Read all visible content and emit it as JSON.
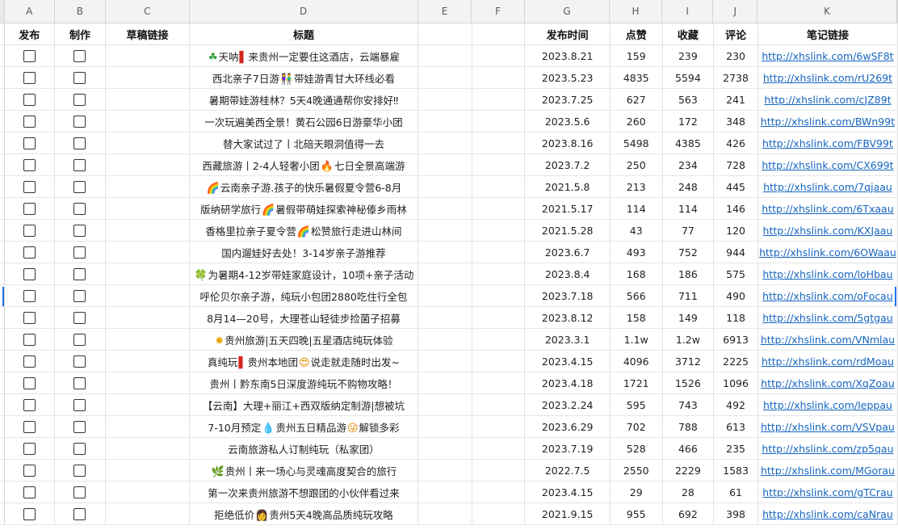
{
  "columns": [
    "A",
    "B",
    "C",
    "D",
    "E",
    "F",
    "G",
    "H",
    "I",
    "J",
    "K"
  ],
  "headers": {
    "publish": "发布",
    "make": "制作",
    "draft_link": "草稿链接",
    "title": "标题",
    "publish_time": "发布时间",
    "likes": "点赞",
    "favorites": "收藏",
    "comments": "评论",
    "note_link": "笔记链接"
  },
  "rows": [
    {
      "pre": "",
      "emoji": "☘",
      "emoji_name": "clover",
      "mid": "天呐",
      "emoji2": "▌",
      "emoji2_name": "bar",
      "post": "来贵州一定要住这酒店，云端暴雇",
      "date": "2023.8.21",
      "likes": "159",
      "fav": "239",
      "comments": "230",
      "link": "http://xhslink.com/6wSF8t"
    },
    {
      "pre": "西北亲子7日游",
      "emoji": "👫",
      "emoji_name": "people",
      "mid": "带娃游青甘大环线必看",
      "emoji2": "",
      "emoji2_name": "",
      "post": "",
      "date": "2023.5.23",
      "likes": "4835",
      "fav": "5594",
      "comments": "2738",
      "link": "http://xhslink.com/rU269t"
    },
    {
      "pre": "暑期带娃游桂林？5天4晚通通帮你安排好‼",
      "emoji": "",
      "emoji_name": "",
      "mid": "",
      "emoji2": "",
      "emoji2_name": "",
      "post": "",
      "date": "2023.7.25",
      "likes": "627",
      "fav": "563",
      "comments": "241",
      "link": "http://xhslink.com/cJZ89t"
    },
    {
      "pre": "一次玩遍美西全景！黄石公园6日游豪华小团",
      "emoji": "",
      "emoji_name": "",
      "mid": "",
      "emoji2": "",
      "emoji2_name": "",
      "post": "",
      "date": "2023.5.6",
      "likes": "260",
      "fav": "172",
      "comments": "348",
      "link": "http://xhslink.com/BWn99t"
    },
    {
      "pre": "替大家试过了丨北碚天眼洞值得一去",
      "emoji": "",
      "emoji_name": "",
      "mid": "",
      "emoji2": "",
      "emoji2_name": "",
      "post": "",
      "date": "2023.8.16",
      "likes": "5498",
      "fav": "4385",
      "comments": "426",
      "link": "http://xhslink.com/FBV99t"
    },
    {
      "pre": "西藏旅游丨2-4人轻奢小团",
      "emoji": "🔥",
      "emoji_name": "fire",
      "mid": "七日全景高端游",
      "emoji2": "",
      "emoji2_name": "",
      "post": "",
      "date": "2023.7.2",
      "likes": "250",
      "fav": "234",
      "comments": "728",
      "link": "http://xhslink.com/CX699t"
    },
    {
      "pre": "",
      "emoji": "🌈",
      "emoji_name": "rainbow",
      "mid": "云南亲子游.孩子的快乐暑假夏令营6-8月",
      "emoji2": "",
      "emoji2_name": "",
      "post": "",
      "date": "2021.5.8",
      "likes": "213",
      "fav": "248",
      "comments": "445",
      "link": "http://xhslink.com/7qjaau"
    },
    {
      "pre": "版纳研学旅行",
      "emoji": "🌈",
      "emoji_name": "rainbow",
      "mid": "暑假带萌娃探索神秘傣乡雨林",
      "emoji2": "",
      "emoji2_name": "",
      "post": "",
      "date": "2021.5.17",
      "likes": "114",
      "fav": "114",
      "comments": "146",
      "link": "http://xhslink.com/6Txaau"
    },
    {
      "pre": "香格里拉亲子夏令营",
      "emoji": "🌈",
      "emoji_name": "rainbow",
      "mid": "松赞旅行走进山林间",
      "emoji2": "",
      "emoji2_name": "",
      "post": "",
      "date": "2021.5.28",
      "likes": "43",
      "fav": "77",
      "comments": "120",
      "link": "http://xhslink.com/KXJaau"
    },
    {
      "pre": "国内遛娃好去处！3-14岁亲子游推荐",
      "emoji": "",
      "emoji_name": "",
      "mid": "",
      "emoji2": "",
      "emoji2_name": "",
      "post": "",
      "date": "2023.6.7",
      "likes": "493",
      "fav": "752",
      "comments": "944",
      "link": "http://xhslink.com/6OWaau"
    },
    {
      "pre": "",
      "emoji": "🍀",
      "emoji_name": "clover",
      "mid": "为暑期4-12岁带娃家庭设计，10项+亲子活动",
      "emoji2": "",
      "emoji2_name": "",
      "post": "",
      "date": "2023.8.4",
      "likes": "168",
      "fav": "186",
      "comments": "575",
      "link": "http://xhslink.com/loHbau"
    },
    {
      "pre": "呼伦贝尔亲子游，纯玩小包团2880吃住行全包",
      "emoji": "",
      "emoji_name": "",
      "mid": "",
      "emoji2": "",
      "emoji2_name": "",
      "post": "",
      "date": "2023.7.18",
      "likes": "566",
      "fav": "711",
      "comments": "490",
      "link": "http://xhslink.com/oFocau"
    },
    {
      "pre": "8月14—20号，大理苍山轻徒步捡菌子招募",
      "emoji": "",
      "emoji_name": "",
      "mid": "",
      "emoji2": "",
      "emoji2_name": "",
      "post": "",
      "date": "2023.8.12",
      "likes": "158",
      "fav": "149",
      "comments": "118",
      "link": "http://xhslink.com/5gtgau"
    },
    {
      "pre": "",
      "emoji": "✸",
      "emoji_name": "star",
      "mid": "贵州旅游|五天四晚|五星酒店纯玩体验",
      "emoji2": "",
      "emoji2_name": "",
      "post": "",
      "date": "2023.3.1",
      "likes": "1.1w",
      "fav": "1.2w",
      "comments": "6913",
      "link": "http://xhslink.com/VNmlau"
    },
    {
      "pre": "真纯玩",
      "emoji": "▌",
      "emoji_name": "bar",
      "mid": "贵州本地团",
      "emoji2": "😍",
      "emoji2_name": "face",
      "post": "说走就走随时出发~",
      "date": "2023.4.15",
      "likes": "4096",
      "fav": "3712",
      "comments": "2225",
      "link": "http://xhslink.com/rdMoau"
    },
    {
      "pre": "贵州丨黔东南5日深度游纯玩不购物攻略！",
      "emoji": "",
      "emoji_name": "",
      "mid": "",
      "emoji2": "",
      "emoji2_name": "",
      "post": "",
      "date": "2023.4.18",
      "likes": "1721",
      "fav": "1526",
      "comments": "1096",
      "link": "http://xhslink.com/XqZoau"
    },
    {
      "pre": "【云南】大理+丽江+西双版纳定制游|想被坑",
      "emoji": "",
      "emoji_name": "",
      "mid": "",
      "emoji2": "",
      "emoji2_name": "",
      "post": "",
      "date": "2023.2.24",
      "likes": "595",
      "fav": "743",
      "comments": "492",
      "link": "http://xhslink.com/Ieppau"
    },
    {
      "pre": "7-10月预定",
      "emoji": "💧",
      "emoji_name": "fire",
      "mid": "贵州五日精品游",
      "emoji2": "😜",
      "emoji2_name": "face",
      "post": "解锁多彩",
      "date": "2023.6.29",
      "likes": "702",
      "fav": "788",
      "comments": "613",
      "link": "http://xhslink.com/VSVpau"
    },
    {
      "pre": "云南旅游私人订制纯玩（私家团）",
      "emoji": "",
      "emoji_name": "",
      "mid": "",
      "emoji2": "",
      "emoji2_name": "",
      "post": "",
      "date": "2023.7.19",
      "likes": "528",
      "fav": "466",
      "comments": "235",
      "link": "http://xhslink.com/zp5qau"
    },
    {
      "pre": "",
      "emoji": "🌿",
      "emoji_name": "leaf",
      "mid": "贵州丨来一场心与灵魂高度契合的旅行",
      "emoji2": "",
      "emoji2_name": "",
      "post": "",
      "date": "2022.7.5",
      "likes": "2550",
      "fav": "2229",
      "comments": "1583",
      "link": "http://xhslink.com/MGorau"
    },
    {
      "pre": "第一次来贵州旅游不想跟团的小伙伴看过来",
      "emoji": "",
      "emoji_name": "",
      "mid": "",
      "emoji2": "",
      "emoji2_name": "",
      "post": "",
      "date": "2023.4.15",
      "likes": "29",
      "fav": "28",
      "comments": "61",
      "link": "http://xhslink.com/gTCrau"
    },
    {
      "pre": "拒绝低价",
      "emoji": "👩",
      "emoji_name": "people",
      "mid": "贵州",
      "emoji2": "",
      "emoji2_name": "",
      "post": "5天4晚高品质纯玩攻略",
      "date": "2021.9.15",
      "likes": "955",
      "fav": "692",
      "comments": "398",
      "link": "http://xhslink.com/caNrau"
    }
  ]
}
